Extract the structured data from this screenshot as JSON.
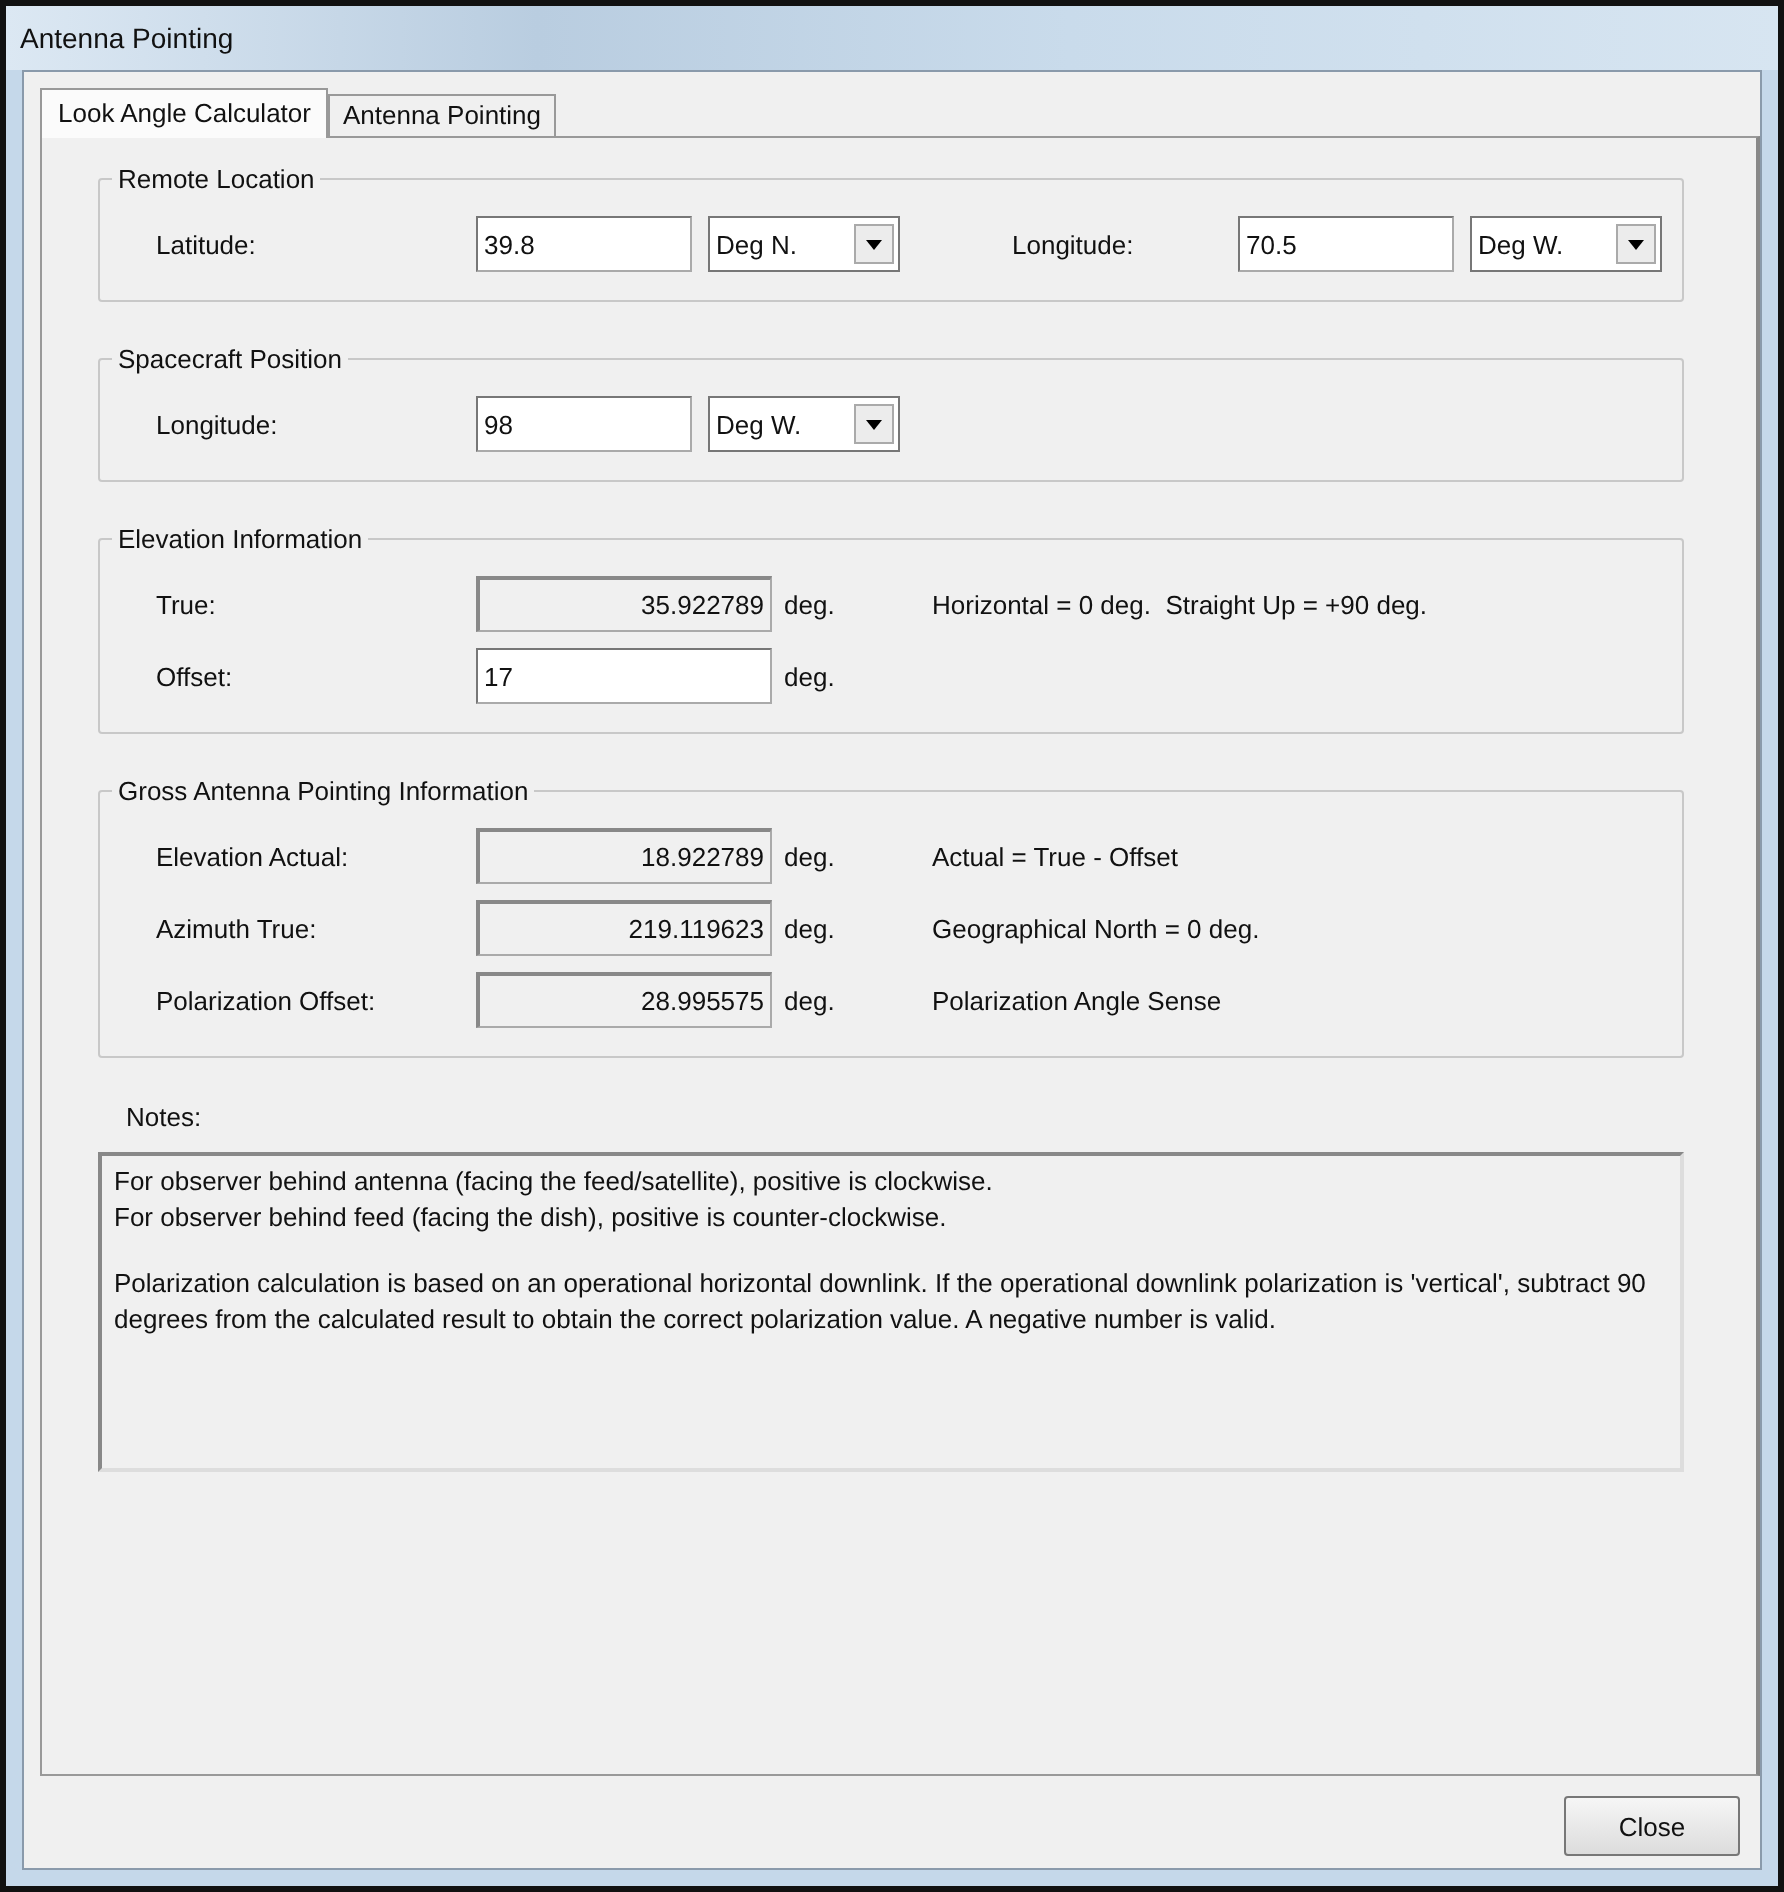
{
  "window": {
    "title": "Antenna Pointing"
  },
  "tabs": [
    {
      "label": "Look Angle Calculator",
      "selected": true
    },
    {
      "label": "Antenna Pointing",
      "selected": false
    }
  ],
  "groups": [
    {
      "title": "Remote Location",
      "fields": [
        {
          "label": "Latitude:",
          "kind": "input",
          "value": "39.8",
          "select": "Deg N."
        },
        {
          "label": "Longitude:",
          "kind": "input",
          "value": "70.5",
          "select": "Deg W."
        }
      ]
    },
    {
      "title": "Spacecraft Position",
      "fields": [
        {
          "label": "Longitude:",
          "kind": "input",
          "value": "98",
          "select": "Deg W."
        }
      ]
    },
    {
      "title": "Elevation Information",
      "fields": [
        {
          "label": "True:",
          "kind": "readonly",
          "value": "35.922789",
          "unit": "deg.",
          "hint": "Horizontal = 0 deg.  Straight Up = +90 deg."
        },
        {
          "label": "Offset:",
          "kind": "input",
          "value": "17",
          "unit": "deg."
        }
      ]
    },
    {
      "title": "Gross Antenna Pointing Information",
      "fields": [
        {
          "label": "Elevation Actual:",
          "kind": "readonly",
          "value": "18.922789",
          "unit": "deg.",
          "hint": "Actual = True - Offset"
        },
        {
          "label": "Azimuth True:",
          "kind": "readonly",
          "value": "219.119623",
          "unit": "deg.",
          "hint": "Geographical North = 0 deg."
        },
        {
          "label": "Polarization Offset:",
          "kind": "readonly",
          "value": "28.995575",
          "unit": "deg.",
          "hint": "Polarization Angle Sense"
        }
      ]
    }
  ],
  "notes": {
    "label": "Notes:",
    "paragraphs": [
      "For observer behind antenna (facing the feed/satellite), positive is clockwise.\nFor observer behind feed (facing the dish), positive is counter-clockwise.",
      "Polarization calculation is based on an operational horizontal downlink. If the operational downlink polarization is 'vertical', subtract 90 degrees from the calculated result to obtain the correct polarization value. A negative number is valid."
    ]
  },
  "buttons": [
    {
      "label": "Close"
    }
  ]
}
